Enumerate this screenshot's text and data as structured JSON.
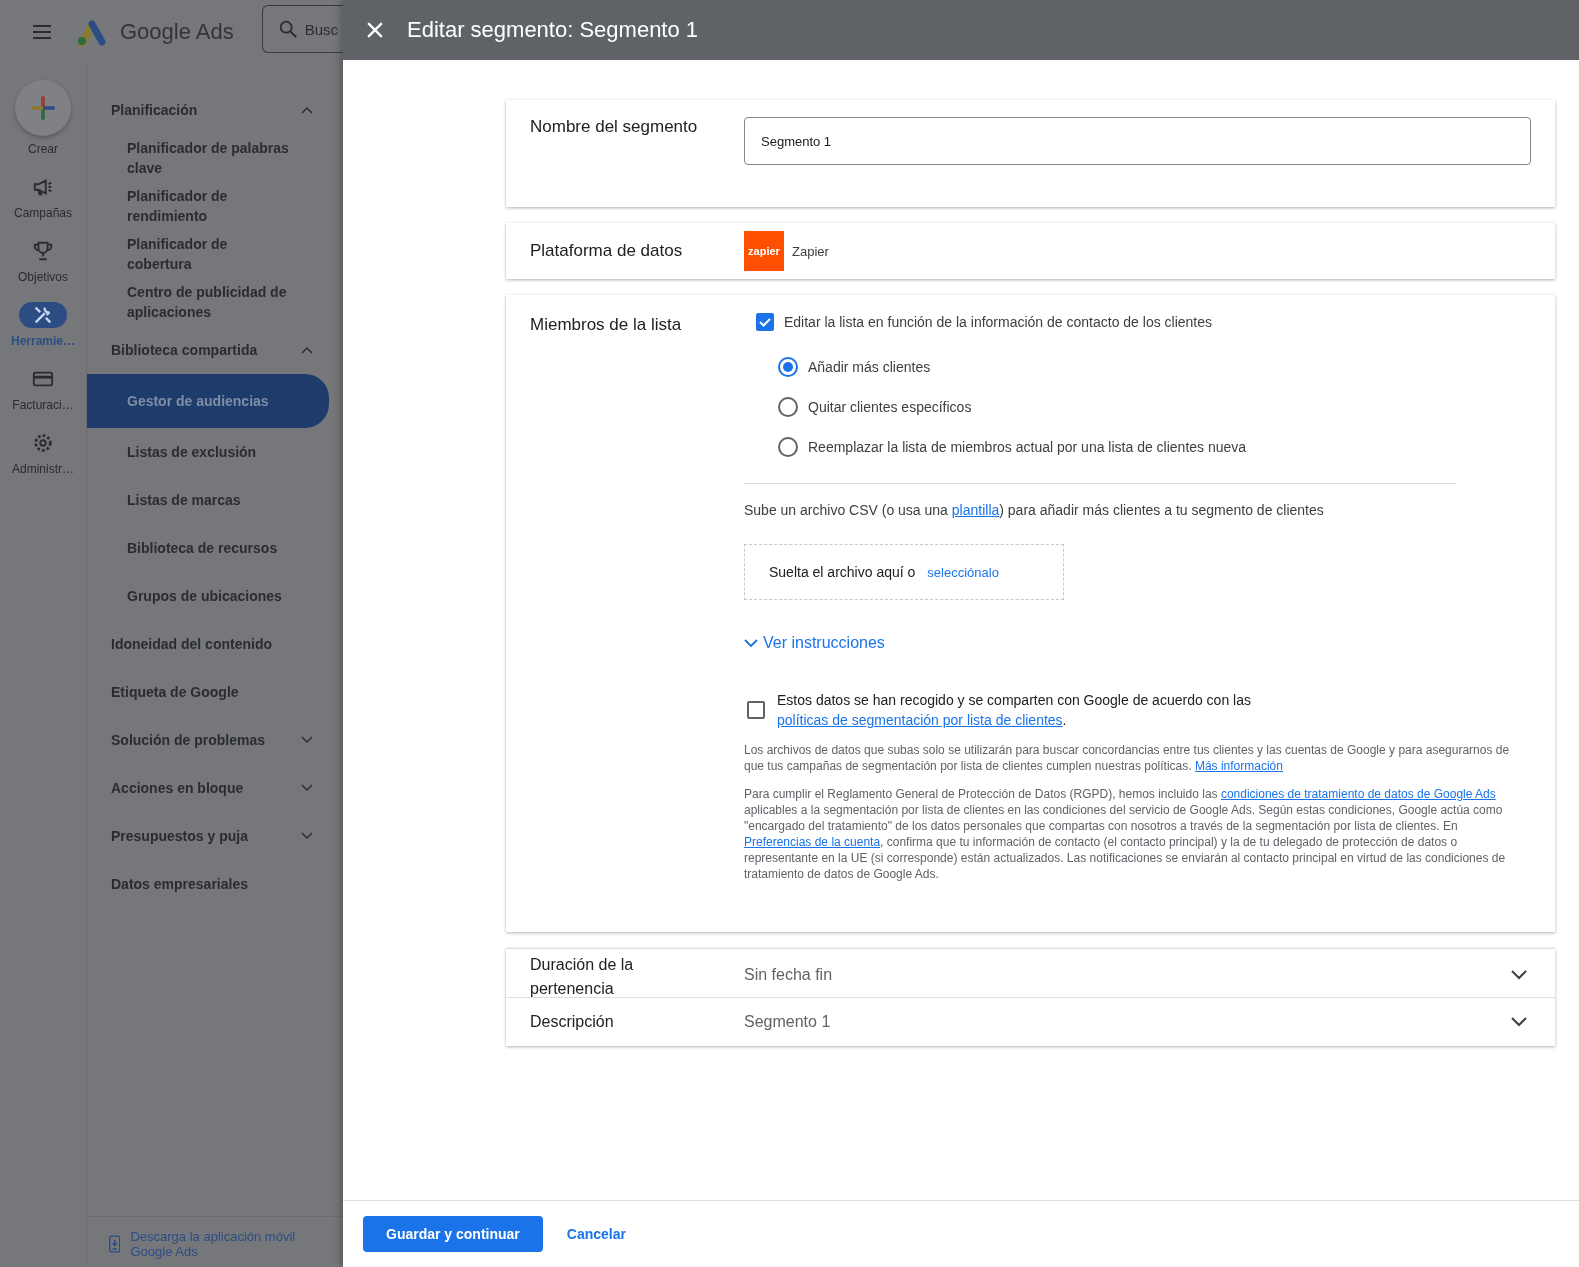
{
  "app": {
    "product_name": "Google Ads",
    "search_placeholder": "Busc"
  },
  "rail": [
    {
      "label": "Crear",
      "selected": false
    },
    {
      "label": "Campañas",
      "selected": false
    },
    {
      "label": "Objetivos",
      "selected": false
    },
    {
      "label": "Herramie…",
      "selected": true
    },
    {
      "label": "Facturaci…",
      "selected": false
    },
    {
      "label": "Administr…",
      "selected": false
    }
  ],
  "nav": [
    {
      "label": "Planificación",
      "kind": "group",
      "expanded": true,
      "children": [
        {
          "label": "Planificador de palabras clave",
          "selected": false
        },
        {
          "label": "Planificador de rendimiento",
          "selected": false
        },
        {
          "label": "Planificador de cobertura",
          "selected": false
        },
        {
          "label": "Centro de publicidad de aplicaciones",
          "selected": false
        }
      ]
    },
    {
      "label": "Biblioteca compartida",
      "kind": "group",
      "expanded": true,
      "children": [
        {
          "label": "Gestor de audiencias",
          "selected": true
        },
        {
          "label": "Listas de exclusión",
          "selected": false
        },
        {
          "label": "Listas de marcas",
          "selected": false
        },
        {
          "label": "Biblioteca de recursos",
          "selected": false
        },
        {
          "label": "Grupos de ubicaciones",
          "selected": false
        }
      ]
    },
    {
      "label": "Idoneidad del contenido",
      "kind": "link"
    },
    {
      "label": "Etiqueta de Google",
      "kind": "link"
    },
    {
      "label": "Solución de problemas",
      "kind": "group",
      "expanded": false
    },
    {
      "label": "Acciones en bloque",
      "kind": "group",
      "expanded": false
    },
    {
      "label": "Presupuestos y puja",
      "kind": "group",
      "expanded": false
    },
    {
      "label": "Datos empresariales",
      "kind": "link"
    }
  ],
  "app_download": "Descarga la aplicación móvil Google Ads",
  "dialog": {
    "title": "Editar segmento: Segmento 1",
    "name_section": {
      "label": "Nombre del segmento",
      "value": "Segmento 1"
    },
    "platform_section": {
      "label": "Plataforma de datos",
      "logo_text": "zapier",
      "name": "Zapier"
    },
    "members_section": {
      "label": "Miembros de la lista",
      "edit_checkbox": {
        "label": "Editar la lista en función de la información de contacto de los clientes",
        "checked": true
      },
      "options": [
        {
          "label": "Añadir más clientes",
          "selected": true
        },
        {
          "label": "Quitar clientes específicos",
          "selected": false
        },
        {
          "label": "Reemplazar la lista de miembros actual por una lista de clientes nueva",
          "selected": false
        }
      ],
      "upload_text": [
        {
          "kind": "text",
          "text": "Sube un archivo CSV (o usa una "
        },
        {
          "kind": "link",
          "text": "plantilla"
        },
        {
          "kind": "text",
          "text": ") para añadir más clientes a tu segmento de clientes"
        }
      ],
      "dropzone": {
        "text": "Suelta el archivo aquí o",
        "link": "selecciónalo"
      },
      "instructions": {
        "label": "Ver instrucciones",
        "expanded": false
      },
      "consent": {
        "checked": false,
        "parts": [
          {
            "kind": "text",
            "text": "Estos datos se han recogido y se comparten con Google de acuerdo con las "
          },
          {
            "kind": "link",
            "text": "políticas de segmentación por lista de clientes"
          },
          {
            "kind": "text",
            "text": "."
          }
        ]
      },
      "notes": [
        [
          {
            "kind": "text",
            "text": "Los archivos de datos que subas solo se utilizarán para buscar concordancias entre tus clientes y las cuentas de Google y para asegurarnos de que tus campañas de segmentación por lista de clientes cumplen nuestras políticas. "
          },
          {
            "kind": "link",
            "text": "Más información"
          }
        ],
        [
          {
            "kind": "text",
            "text": "Para cumplir el Reglamento General de Protección de Datos (RGPD), hemos incluido las "
          },
          {
            "kind": "link",
            "text": "condiciones de tratamiento de datos de Google Ads"
          },
          {
            "kind": "text",
            "text": " aplicables a la segmentación por lista de clientes en las condiciones del servicio de Google Ads. Según estas condiciones, Google actúa como \"encargado del tratamiento\" de los datos personales que compartas con nosotros a través de la segmentación por lista de clientes. En "
          },
          {
            "kind": "link",
            "text": "Preferencias de la cuenta"
          },
          {
            "kind": "text",
            "text": ", confirma que tu información de contacto (el contacto principal) y la de tu delegado de protección de datos o representante en la UE (si corresponde) están actualizados. Las notificaciones se enviarán al contacto principal en virtud de las condiciones de tratamiento de datos de Google Ads."
          }
        ]
      ]
    },
    "accordions": [
      {
        "label": "Duración de la pertenencia",
        "value": "Sin fecha fin",
        "expanded": false
      },
      {
        "label": "Descripción",
        "value": "Segmento 1",
        "expanded": false
      }
    ],
    "buttons": [
      {
        "label": "Guardar y continuar",
        "kind": "primary"
      },
      {
        "label": "Cancelar",
        "kind": "text"
      }
    ]
  }
}
